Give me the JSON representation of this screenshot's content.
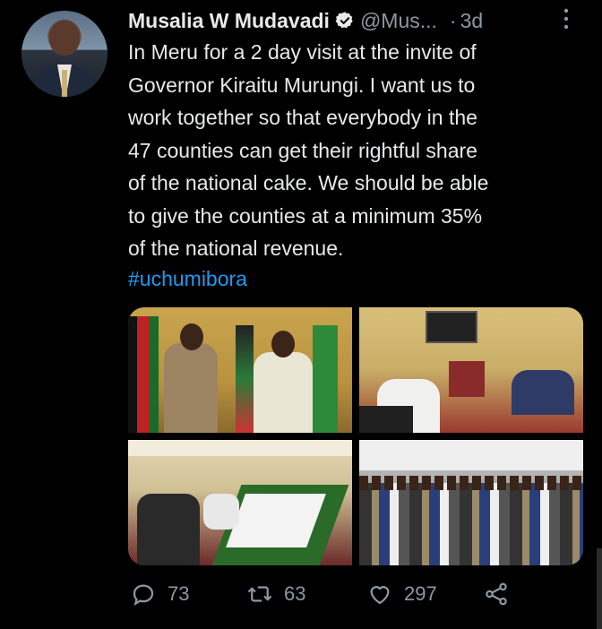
{
  "tweet": {
    "author_name": "Musalia W Mudavadi",
    "handle": "@Mus...",
    "separator": "·",
    "time": "3d",
    "text": "In Meru for a 2 day visit at the invite of\nGovernor Kiraitu Murungi. I want us to\nwork together so that everybody in the\n47 counties can get their rightful share\nof the national cake. We should be able\nto give the counties at a minimum 35%\nof the national revenue.",
    "hashtag": "#uchumibora",
    "photo_count": 4
  },
  "actions": {
    "replies": "73",
    "retweets": "63",
    "likes": "297"
  },
  "icons": [
    "verified-icon",
    "more-icon",
    "reply-icon",
    "retweet-icon",
    "like-icon",
    "share-icon"
  ],
  "colors": {
    "background": "#000000",
    "text": "#e7e9ea",
    "muted": "#8b98a5",
    "link": "#1d9bf0"
  }
}
